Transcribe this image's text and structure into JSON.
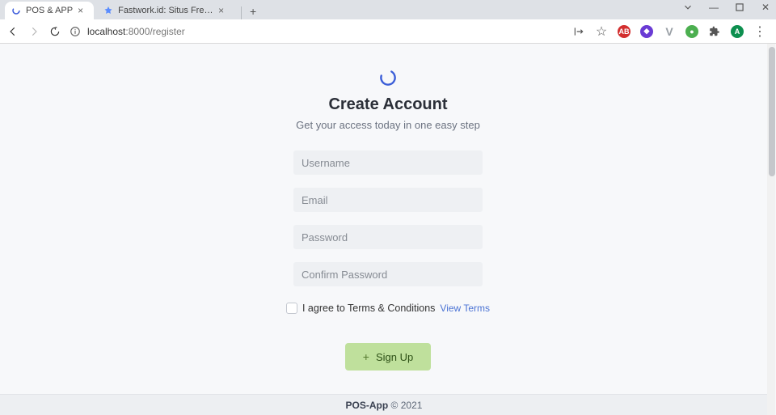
{
  "browser": {
    "tabs": [
      {
        "title": "POS & APP",
        "active": true
      },
      {
        "title": "Fastwork.id: Situs Freelance Onli",
        "active": false
      }
    ],
    "url": "localhost:8000/register",
    "url_host": "localhost",
    "url_rest": ":8000/register"
  },
  "page": {
    "title": "Create Account",
    "subtitle": "Get your access today in one easy step",
    "placeholders": {
      "username": "Username",
      "email": "Email",
      "password": "Password",
      "confirm_password": "Confirm Password"
    },
    "terms_label": "I agree to Terms & Conditions",
    "view_terms": "View Terms",
    "signup_label": "Sign Up",
    "footer_brand": "POS-App",
    "footer_rest": " © 2021"
  }
}
